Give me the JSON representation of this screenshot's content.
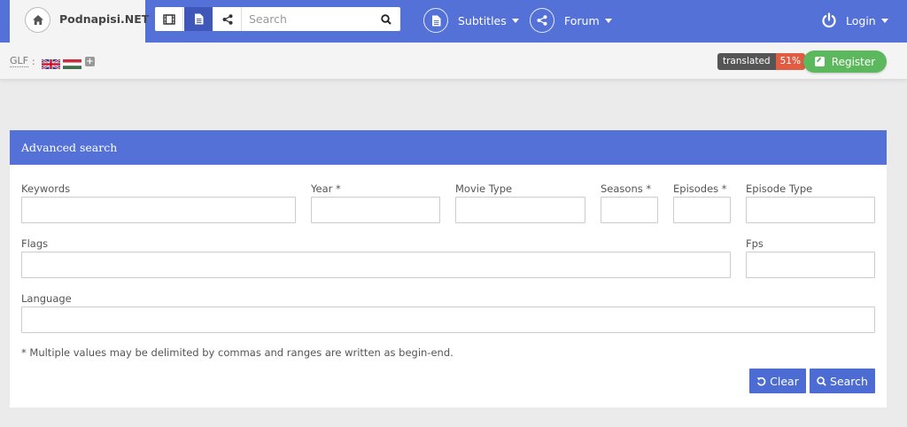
{
  "brand": {
    "name": "Podnapisi.NET"
  },
  "navbar": {
    "search_placeholder": "Search",
    "subtitles_label": "Subtitles",
    "forum_label": "Forum",
    "login_label": "Login"
  },
  "subbar": {
    "glf_label": "GLF",
    "glf_colon": ":",
    "plus": "+",
    "translated_label": "translated",
    "translated_percent": "51%",
    "register_label": "Register"
  },
  "panel": {
    "title": "Advanced search",
    "fields": {
      "keywords": "Keywords",
      "year": "Year *",
      "movie_type": "Movie Type",
      "seasons": "Seasons *",
      "episodes": "Episodes *",
      "episode_type": "Episode Type",
      "flags": "Flags",
      "fps": "Fps",
      "language": "Language"
    },
    "note": "* Multiple values may be delimited by commas and ranges are written as begin-end.",
    "clear_label": "Clear",
    "search_label": "Search"
  },
  "colors": {
    "primary": "#5471d8",
    "button": "#4c6cd4",
    "success": "#5cb85c",
    "badge_percent": "#e05d44"
  }
}
